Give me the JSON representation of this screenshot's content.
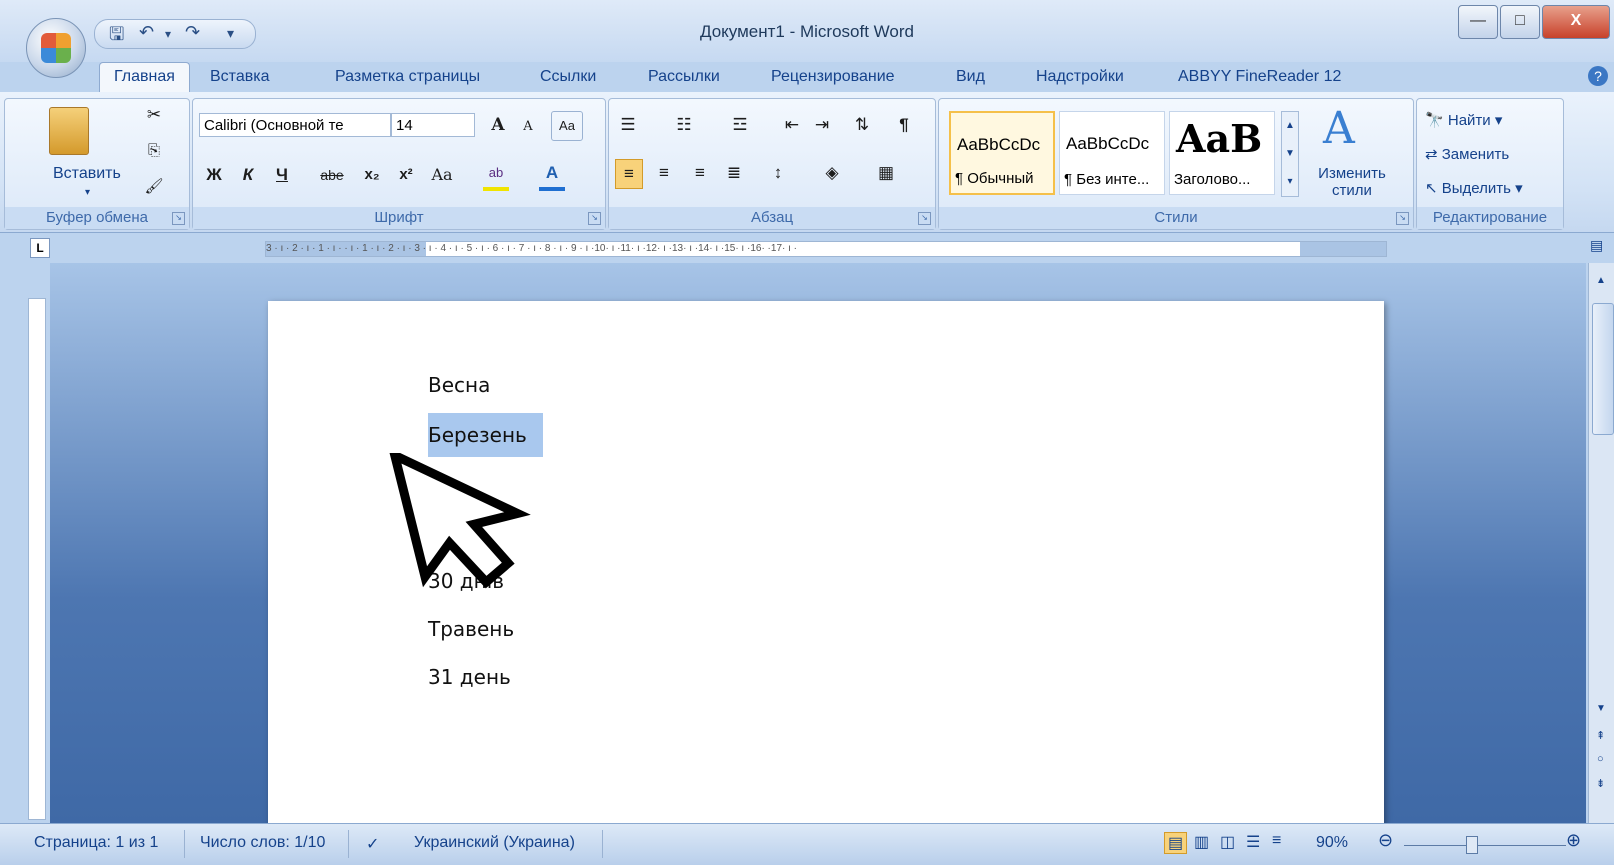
{
  "window": {
    "title": "Документ1 - Microsoft Word"
  },
  "quick_access": {
    "save_icon": "save-icon",
    "undo_icon": "undo-icon",
    "redo_icon": "redo-icon",
    "customize": "▾"
  },
  "window_buttons": {
    "minimize": "—",
    "maximize": "□",
    "close": "X"
  },
  "tabs": [
    "Главная",
    "Вставка",
    "Разметка страницы",
    "Ссылки",
    "Рассылки",
    "Рецензирование",
    "Вид",
    "Надстройки",
    "ABBYY FineReader 12"
  ],
  "help_icon": "help-icon",
  "ribbon": {
    "clipboard": {
      "paste_label": "Вставить",
      "group_label": "Буфер обмена"
    },
    "font": {
      "font_name": "Calibri (Основной те",
      "font_size": "14",
      "grow": "A",
      "shrink": "A",
      "clear": "Aa",
      "bold": "Ж",
      "italic": "К",
      "underline": "Ч",
      "strike": "abe",
      "subscript": "x₂",
      "superscript": "x²",
      "case": "Aa",
      "highlight": "ab",
      "color": "A",
      "group_label": "Шрифт"
    },
    "paragraph": {
      "group_label": "Абзац",
      "pilcrow": "¶"
    },
    "styles": {
      "tiles": [
        {
          "sample": "AaBbCcDc",
          "name": "¶ Обычный"
        },
        {
          "sample": "AaBbCcDc",
          "name": "¶ Без инте..."
        },
        {
          "sample": "AaB",
          "name": "Заголово..."
        }
      ],
      "change_styles_line1": "Изменить",
      "change_styles_line2": "стили",
      "group_label": "Стили"
    },
    "editing": {
      "find": "Найти",
      "replace": "Заменить",
      "select": "Выделить",
      "group_label": "Редактирование"
    }
  },
  "ruler": {
    "text": "3 · ı · 2 · ı · 1 · ı ·   · ı · 1 · ı · 2 · ı · 3 · ı · 4 · ı · 5 · ı · 6 · ı · 7 · ı · 8 · ı · 9 · ı ·10· ı ·11· ı ·12· ı ·13· ı ·14· ı ·15· ı ·16·   ·17· ı ·"
  },
  "document": {
    "lines": [
      "Весна",
      "Березень",
      "",
      "",
      "30 днів",
      "Травень",
      "31 день"
    ]
  },
  "status": {
    "page": "Страница: 1 из 1",
    "words": "Число слов: 1/10",
    "language": "Украинский (Украина)",
    "zoom": "90%"
  },
  "colors": {
    "ribbon": "#dbe8f8",
    "selection": "#a9c8ee",
    "accent": "#15428b"
  }
}
